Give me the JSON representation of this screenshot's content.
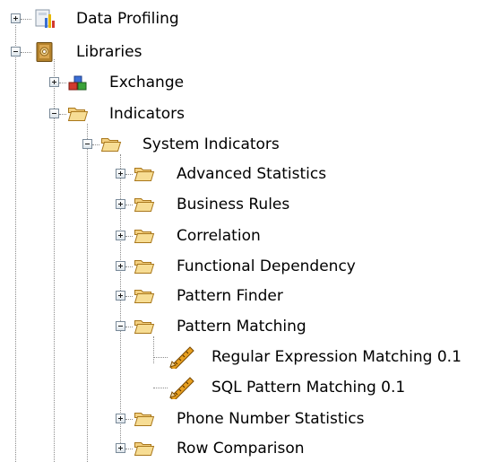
{
  "tree": {
    "nodes": [
      {
        "label": "Data Profiling",
        "icon": "data-profiling-icon",
        "state": "collapsed"
      },
      {
        "label": "Libraries",
        "icon": "library-book-icon",
        "state": "expanded"
      },
      {
        "label": "Exchange",
        "icon": "exchange-icon",
        "state": "collapsed"
      },
      {
        "label": "Indicators",
        "icon": "folder-open-icon",
        "state": "expanded"
      },
      {
        "label": "System Indicators",
        "icon": "folder-open-icon",
        "state": "expanded"
      },
      {
        "label": "Advanced Statistics",
        "icon": "folder-open-icon",
        "state": "collapsed"
      },
      {
        "label": "Business Rules",
        "icon": "folder-open-icon",
        "state": "collapsed"
      },
      {
        "label": "Correlation",
        "icon": "folder-open-icon",
        "state": "collapsed"
      },
      {
        "label": "Functional Dependency",
        "icon": "folder-open-icon",
        "state": "collapsed"
      },
      {
        "label": "Pattern Finder",
        "icon": "folder-open-icon",
        "state": "collapsed"
      },
      {
        "label": "Pattern Matching",
        "icon": "folder-open-icon",
        "state": "expanded"
      },
      {
        "label": "Regular Expression Matching 0.1",
        "icon": "ruler-pencil-icon",
        "state": "leaf"
      },
      {
        "label": "SQL Pattern Matching 0.1",
        "icon": "ruler-pencil-icon",
        "state": "leaf"
      },
      {
        "label": "Phone Number Statistics",
        "icon": "folder-open-icon",
        "state": "collapsed"
      },
      {
        "label": "Row Comparison",
        "icon": "folder-open-icon",
        "state": "collapsed"
      }
    ]
  }
}
